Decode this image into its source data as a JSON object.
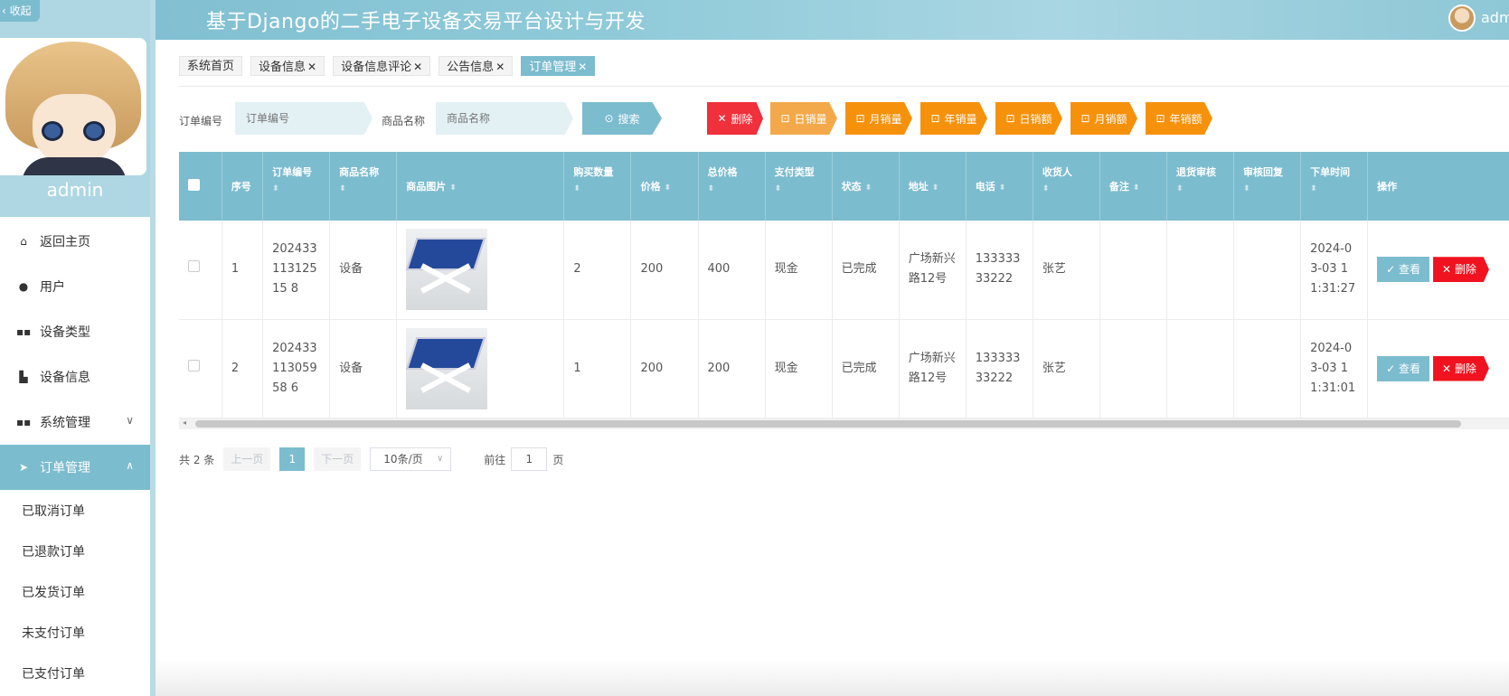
{
  "header": {
    "title": "基于Django的二手电子设备交易平台设计与开发",
    "user": "adm"
  },
  "sidebar": {
    "collapse_label": "收起",
    "profile_name": "admin",
    "menu": [
      {
        "label": "返回主页",
        "icon": "home-icon"
      },
      {
        "label": "用户",
        "icon": "user-icon"
      },
      {
        "label": "设备类型",
        "icon": "grid-icon"
      },
      {
        "label": "设备信息",
        "icon": "thumbs-icon"
      },
      {
        "label": "系统管理",
        "icon": "grid-icon",
        "expandable": true
      },
      {
        "label": "订单管理",
        "icon": "send-icon",
        "expandable": true,
        "active": true
      }
    ],
    "submenu": [
      "已取消订单",
      "已退款订单",
      "已发货订单",
      "未支付订单",
      "已支付订单"
    ]
  },
  "tabs": [
    {
      "label": "系统首页",
      "closable": false
    },
    {
      "label": "设备信息",
      "closable": true
    },
    {
      "label": "设备信息评论",
      "closable": true
    },
    {
      "label": "公告信息",
      "closable": true
    },
    {
      "label": "订单管理",
      "closable": true,
      "active": true
    }
  ],
  "search": {
    "order_no_label": "订单编号",
    "order_no_placeholder": "订单编号",
    "product_label": "商品名称",
    "product_placeholder": "商品名称",
    "search_btn": "搜索",
    "delete_btn": "删除",
    "stat_buttons": [
      "日销量",
      "月销量",
      "年销量",
      "日销额",
      "月销额",
      "年销额"
    ]
  },
  "table": {
    "columns": [
      "序号",
      "订单编号",
      "商品名称",
      "商品图片",
      "购买数量",
      "价格",
      "总价格",
      "支付类型",
      "状态",
      "地址",
      "电话",
      "收货人",
      "备注",
      "退货审核",
      "审核回复",
      "下单时间",
      "操作"
    ],
    "rows": [
      {
        "index": "1",
        "order_no": "20243311312515 8",
        "product": "设备",
        "qty": "2",
        "price": "200",
        "total": "400",
        "pay": "现金",
        "status": "已完成",
        "address": "广场新兴路12号",
        "phone": "13333333222",
        "receiver": "张艺",
        "remark": "",
        "return_audit": "",
        "audit_reply": "",
        "time": "2024-03-03 11:31:27"
      },
      {
        "index": "2",
        "order_no": "20243311305958 6",
        "product": "设备",
        "qty": "1",
        "price": "200",
        "total": "200",
        "pay": "现金",
        "status": "已完成",
        "address": "广场新兴路12号",
        "phone": "13333333222",
        "receiver": "张艺",
        "remark": "",
        "return_audit": "",
        "audit_reply": "",
        "time": "2024-03-03 11:31:01"
      }
    ],
    "view_btn": "查看",
    "delete_btn": "删除"
  },
  "pagination": {
    "total": "共 2 条",
    "prev": "上一页",
    "current": "1",
    "next": "下一页",
    "page_size": "10条/页",
    "goto_label": "前往",
    "goto_value": "1",
    "page_unit": "页"
  },
  "colors": {
    "accent": "#7cbccf",
    "danger": "#f0303b",
    "orange": "#f6910c"
  }
}
